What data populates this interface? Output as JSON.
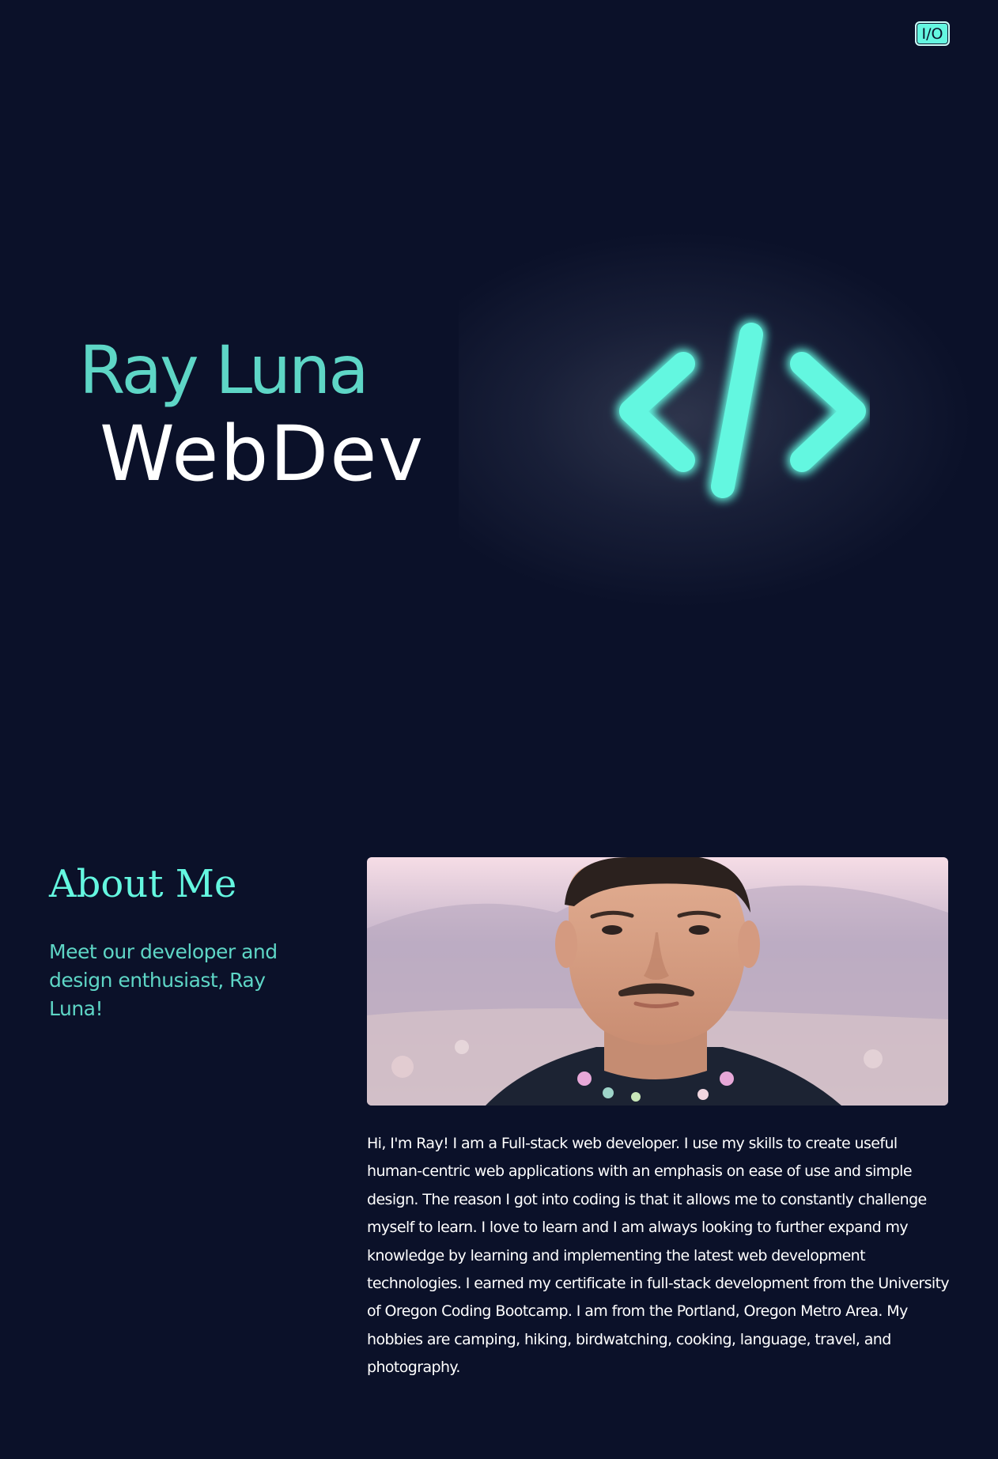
{
  "nav": {
    "toggle_label": "I/O"
  },
  "hero": {
    "name": "Ray Luna",
    "role": "WebDev",
    "icon": "code-brackets-icon",
    "icon_color": "#64f7e0"
  },
  "about": {
    "title": "About Me",
    "tagline": "Meet our developer and design enthusiast, Ray Luna!",
    "photo": "portrait-photo",
    "bio": "Hi, I'm Ray! I am a Full-stack web developer. I use my skills to create useful human-centric web applications with an emphasis on ease of use and simple design. The reason I got into coding is that it allows me to constantly challenge myself to learn. I love to learn and I am always looking to further expand my knowledge by learning and implementing the latest web development technologies. I earned my certificate in full-stack development from the University of Oregon Coding Bootcamp. I am from the Portland, Oregon Metro Area. My hobbies are camping, hiking, birdwatching, cooking, language, travel, and photography."
  },
  "colors": {
    "background": "#0b1129",
    "accent": "#64f7e0",
    "accent_muted": "#5ed6c6",
    "text": "#ffffff"
  }
}
